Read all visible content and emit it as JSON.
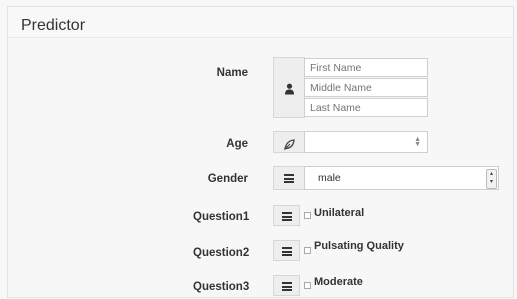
{
  "panel": {
    "title": "Predictor"
  },
  "form": {
    "name": {
      "label": "Name",
      "icon": "user-icon",
      "first_placeholder": "First Name",
      "middle_placeholder": "Middle Name",
      "last_placeholder": "Last Name"
    },
    "age": {
      "label": "Age",
      "icon": "leaf-icon",
      "value": "",
      "spinner_icon": "spinner-arrows-icon"
    },
    "gender": {
      "label": "Gender",
      "icon": "list-icon",
      "selected": "male"
    },
    "questions": [
      {
        "label": "Question1",
        "icon": "list-icon",
        "option": "Unilateral",
        "checked": false
      },
      {
        "label": "Question2",
        "icon": "list-icon",
        "option": "Pulsating Quality",
        "checked": false
      },
      {
        "label": "Question3",
        "icon": "list-icon",
        "option": "Moderate",
        "checked": false
      }
    ]
  }
}
